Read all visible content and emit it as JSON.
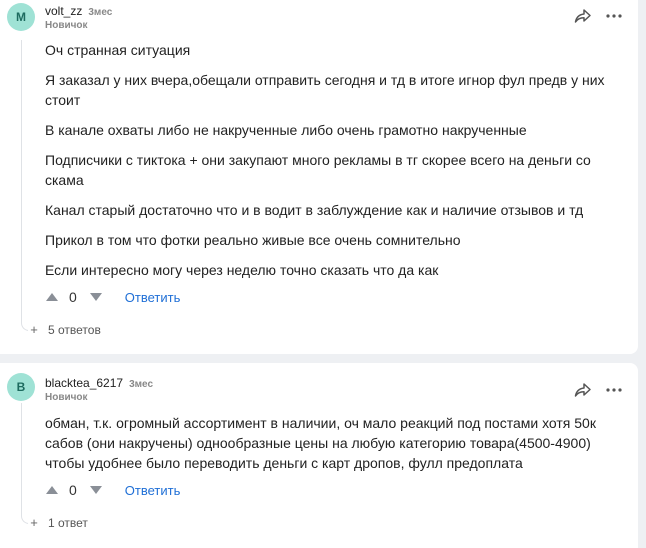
{
  "comments": [
    {
      "avatar_letter": "M",
      "avatar_color": "#9fe2d5",
      "author": "volt_zz",
      "time": "3мес",
      "role": "Новичок",
      "paragraphs": [
        "Оч странная ситуация",
        "Я заказал у них вчера,обещали отправить сегодня и тд в итоге игнор фул предв у них стоит",
        "В канале охваты либо не накрученные либо очень грамотно накрученные",
        "Подписчики с тиктока + они закупают много рекламы в тг скорее всего на деньги со скама",
        "Канал старый достаточно что и в водит в заблуждение как и наличие отзывов и тд",
        "Прикол в том что фотки реально живые все очень сомнительно",
        "Если интересно могу через неделю точно сказать что да как"
      ],
      "score": "0",
      "reply_label": "Ответить",
      "replies_label": "5 ответов",
      "icons": [
        "share-icon",
        "more-icon",
        "upvote-icon",
        "downvote-icon",
        "expand-plus-icon"
      ]
    },
    {
      "avatar_letter": "B",
      "avatar_color": "#9fe2d5",
      "author": "blacktea_6217",
      "time": "3мес",
      "role": "Новичок",
      "paragraphs": [
        "обман, т.к. огромный ассортимент в наличии, оч мало реакций под постами хотя 50к сабов (они накручены) однообразные цены на любую категорию товара(4500-4900) чтобы удобнее было переводить деньги с карт дропов, фулл предоплата"
      ],
      "score": "0",
      "reply_label": "Ответить",
      "replies_label": "1 ответ"
    }
  ],
  "colors": {
    "accent": "#1f6fd6",
    "background": "#eef0f3",
    "card": "#ffffff"
  }
}
